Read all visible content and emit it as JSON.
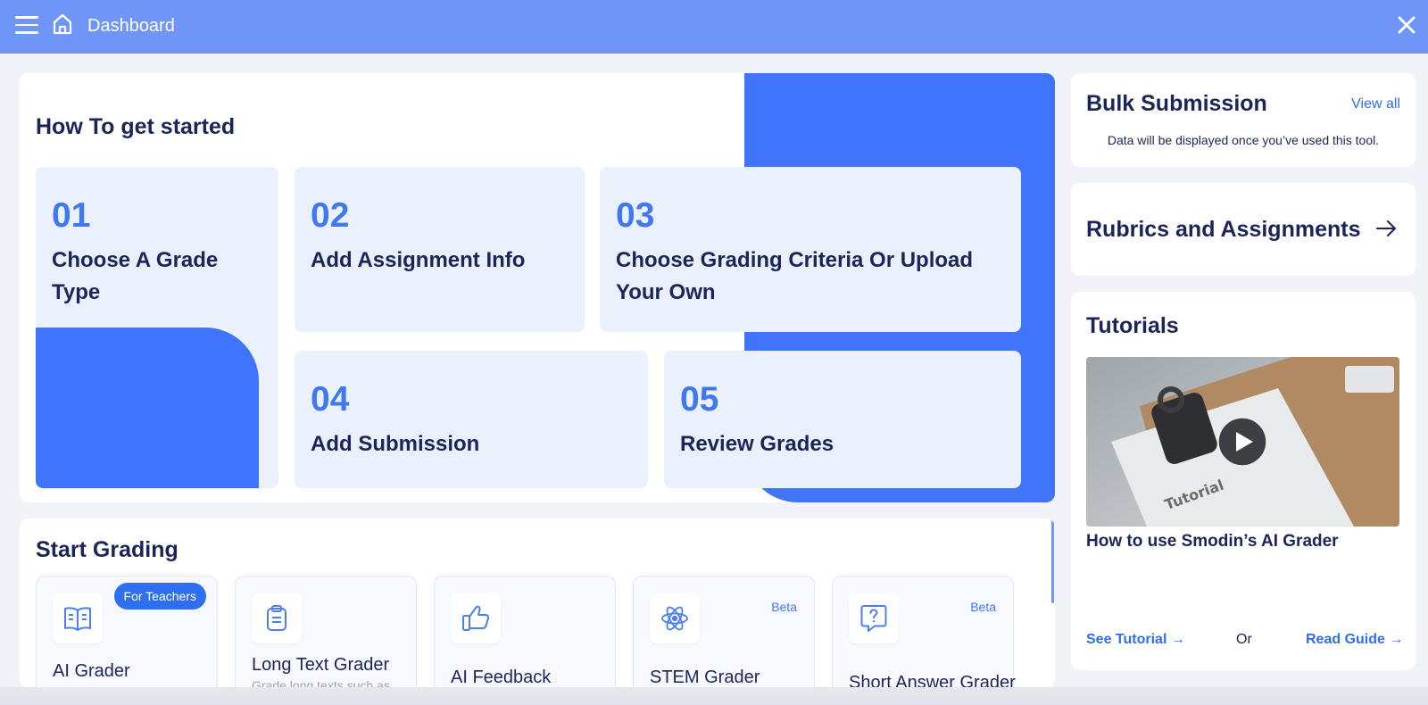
{
  "header": {
    "title": "Dashboard"
  },
  "started": {
    "title": "How To get started",
    "steps": [
      {
        "num": "01",
        "label_line1": "Choose A Grade",
        "label_line2": "Type"
      },
      {
        "num": "02",
        "label_line1": "Add Assignment Info",
        "label_line2": ""
      },
      {
        "num": "03",
        "label_line1": "Choose Grading Criteria Or Upload",
        "label_line2": "Your Own"
      },
      {
        "num": "04",
        "label_line1": "Add Submission",
        "label_line2": ""
      },
      {
        "num": "05",
        "label_line1": "Review Grades",
        "label_line2": ""
      }
    ]
  },
  "grading": {
    "title": "Start Grading",
    "tools": [
      {
        "name": "AI Grader",
        "badge": "For Teachers",
        "icon": "book-icon",
        "desc": ""
      },
      {
        "name": "Long Text Grader",
        "badge": "",
        "icon": "clipboard-icon",
        "desc": "Grade long texts such as"
      },
      {
        "name": "AI Feedback",
        "badge": "",
        "icon": "thumbs-up-icon",
        "desc": ""
      },
      {
        "name": "STEM Grader",
        "badge": "Beta",
        "icon": "atom-icon",
        "desc": ""
      },
      {
        "name": "Short Answer Grader",
        "badge": "Beta",
        "icon": "question-bubble-icon",
        "desc": ""
      }
    ]
  },
  "bulk": {
    "title": "Bulk Submission",
    "link": "View all",
    "note": "Data will be displayed once you’ve used this tool."
  },
  "rubrics": {
    "title": "Rubrics and Assignments"
  },
  "tutorials": {
    "title": "Tutorials",
    "video_caption": "How to use Smodin’s AI Grader",
    "video_paper_text": "Tutorial",
    "see_tutorial": "See Tutorial",
    "or": "Or",
    "read_guide": "Read Guide"
  },
  "colors": {
    "topbar": "#6e95f7",
    "accent": "#4075fb",
    "link": "#2e6ef0",
    "heading": "#1b2559",
    "step_bg": "#ebf0fd"
  }
}
